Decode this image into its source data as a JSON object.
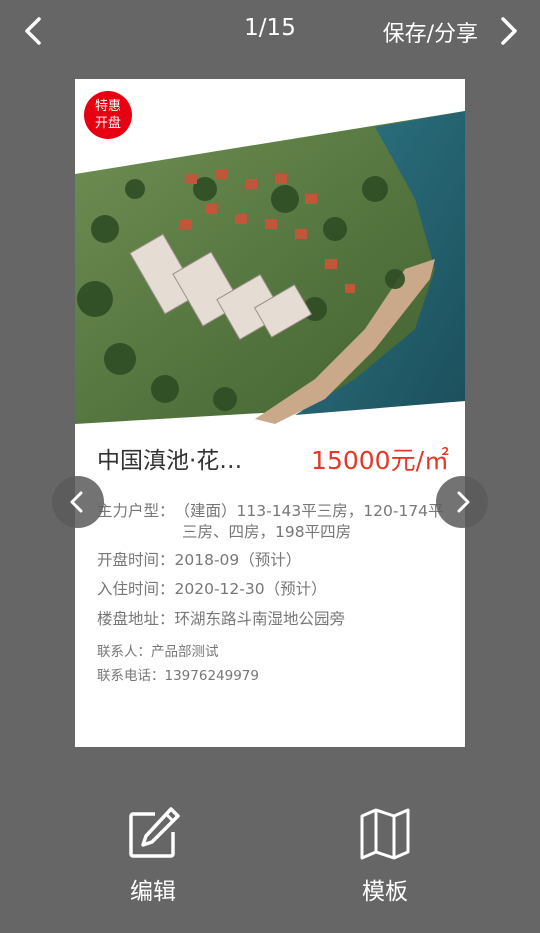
{
  "topbar": {
    "counter": "1/15",
    "save_share": "保存/分享"
  },
  "card": {
    "badge_line1": "特惠",
    "badge_line2": "开盘",
    "title": "中国滇池·花…",
    "price": "15000元/㎡",
    "house_type_label": "主力户型：",
    "house_type_line1": "（建面）113-143平三房，120-174平",
    "house_type_line2": "三房、四房，198平四房",
    "open_time_label": "开盘时间：",
    "open_time": "2018-09（预计）",
    "move_in_label": "入住时间：",
    "move_in": "2020-12-30（预计）",
    "address_label": "楼盘地址：",
    "address": "环湖东路斗南湿地公园旁",
    "contact_label": "联系人：",
    "contact": "产品部测试",
    "phone_label": "联系电话：",
    "phone": "13976249979"
  },
  "toolbar": {
    "edit_label": "编辑",
    "template_label": "模板"
  },
  "colors": {
    "background": "#666666",
    "price": "#e63728",
    "badge": "#e60012"
  },
  "icons": {
    "back": "chevron-left-icon",
    "next": "chevron-right-icon",
    "edit": "edit-icon",
    "template": "map-icon"
  }
}
